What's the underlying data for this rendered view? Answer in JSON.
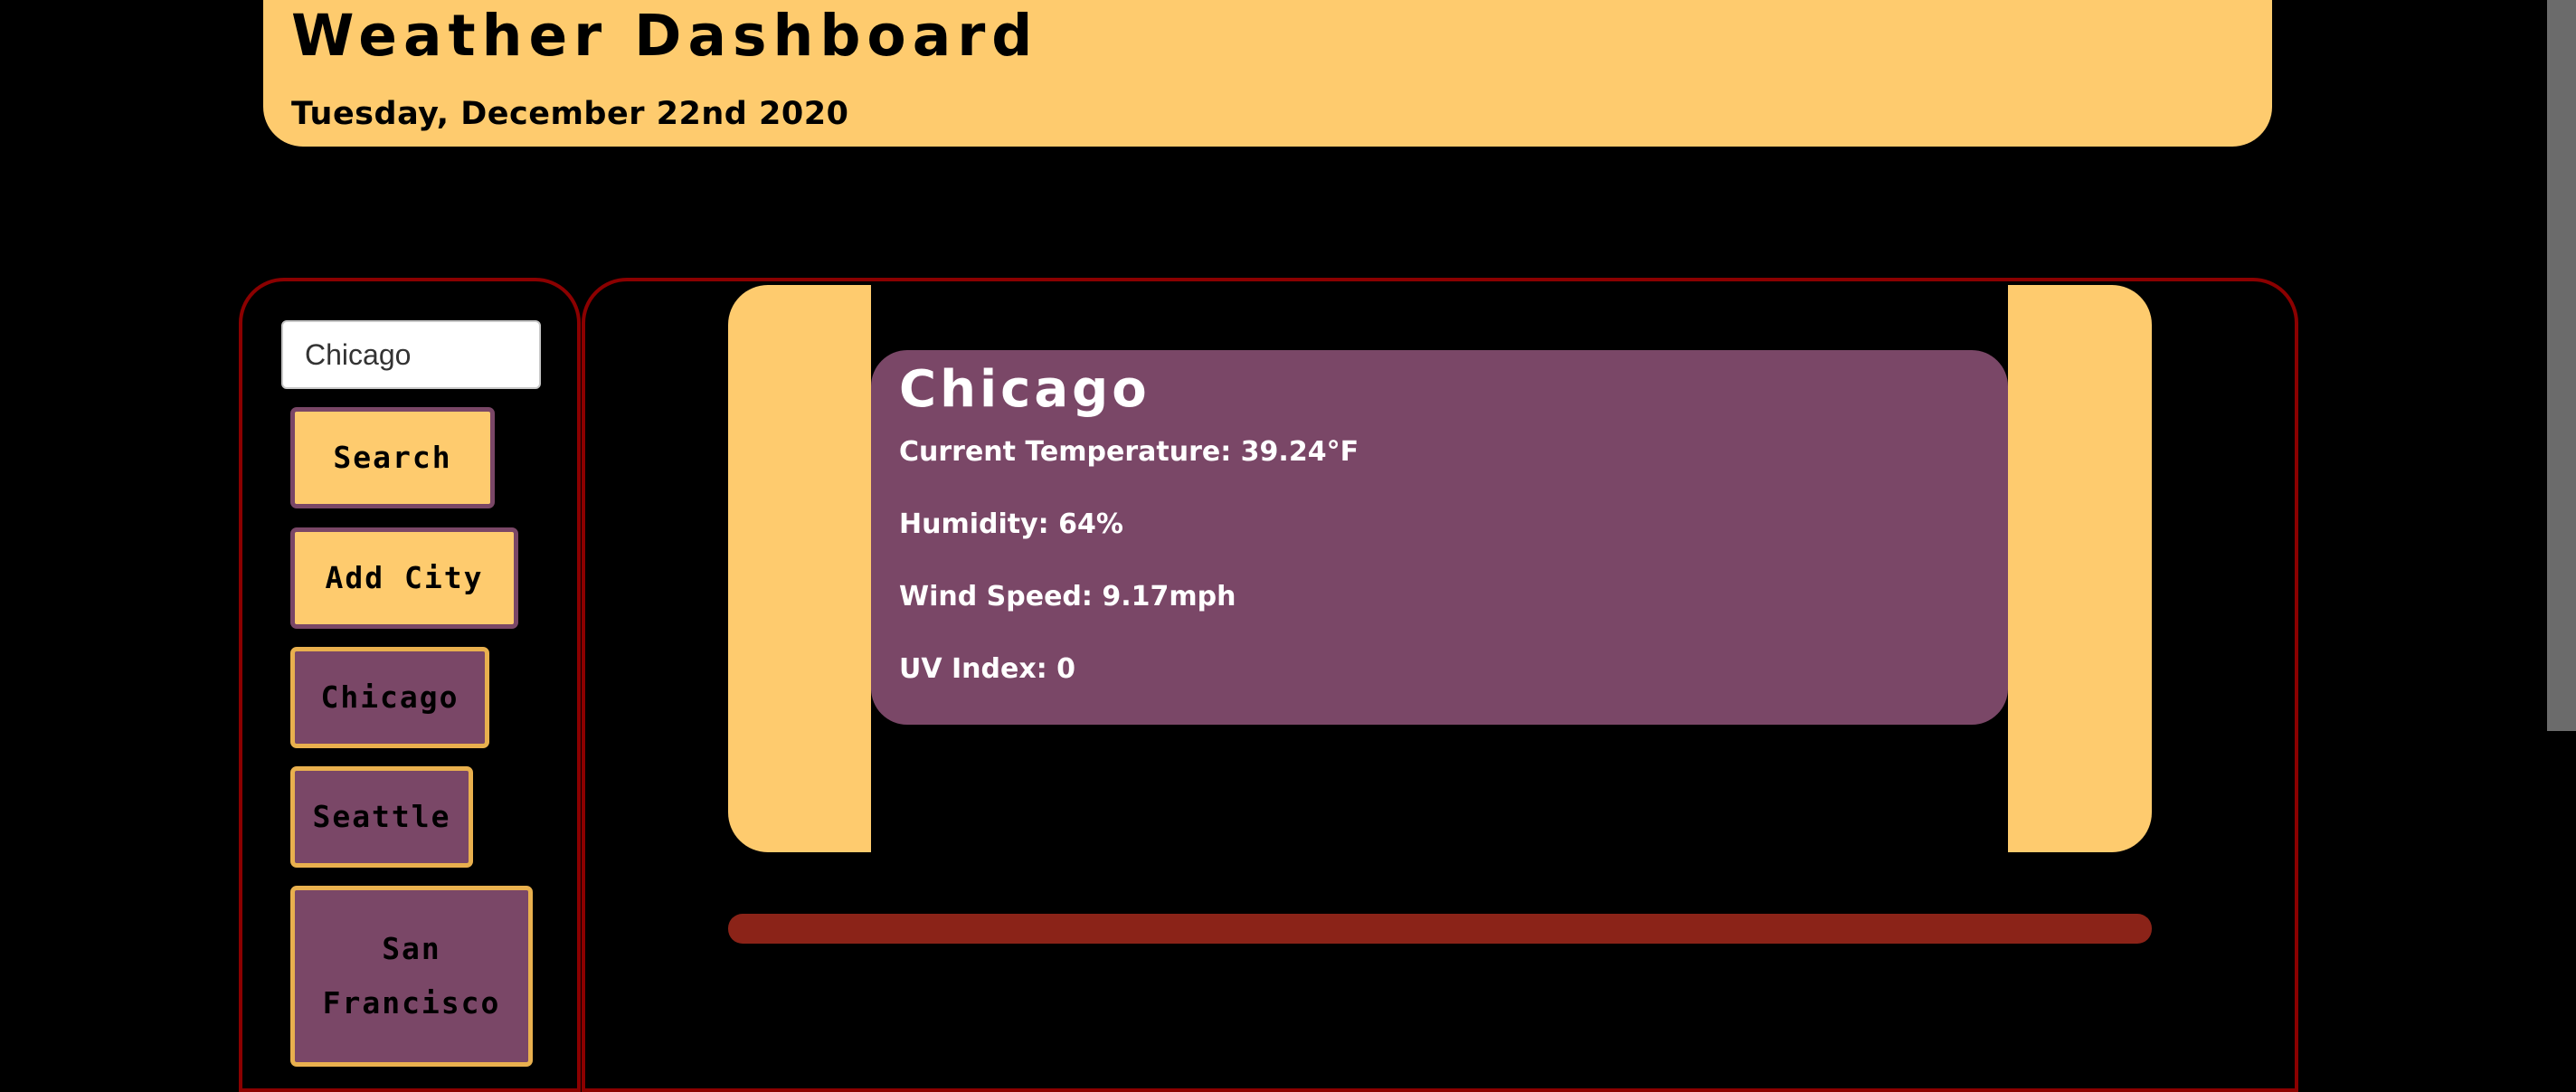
{
  "header": {
    "title": "Weather Dashboard",
    "date": "Tuesday, December 22nd 2020"
  },
  "sidebar": {
    "search_value": "Chicago",
    "search_label": "Search",
    "add_city_label": "Add City",
    "cities": [
      "Chicago",
      "Seattle",
      "San Francisco"
    ]
  },
  "current": {
    "city": "Chicago",
    "temperature": "Current Temperature: 39.24°F",
    "humidity": "Humidity: 64%",
    "wind": "Wind Speed: 9.17mph",
    "uv": "UV Index: 0"
  },
  "colors": {
    "background": "#000000",
    "accent": "#fecb6e",
    "card": "#7a4767",
    "border": "#8b0000",
    "bar": "#8b2318"
  },
  "scrollbar": {
    "visible_fraction": 0.72
  }
}
